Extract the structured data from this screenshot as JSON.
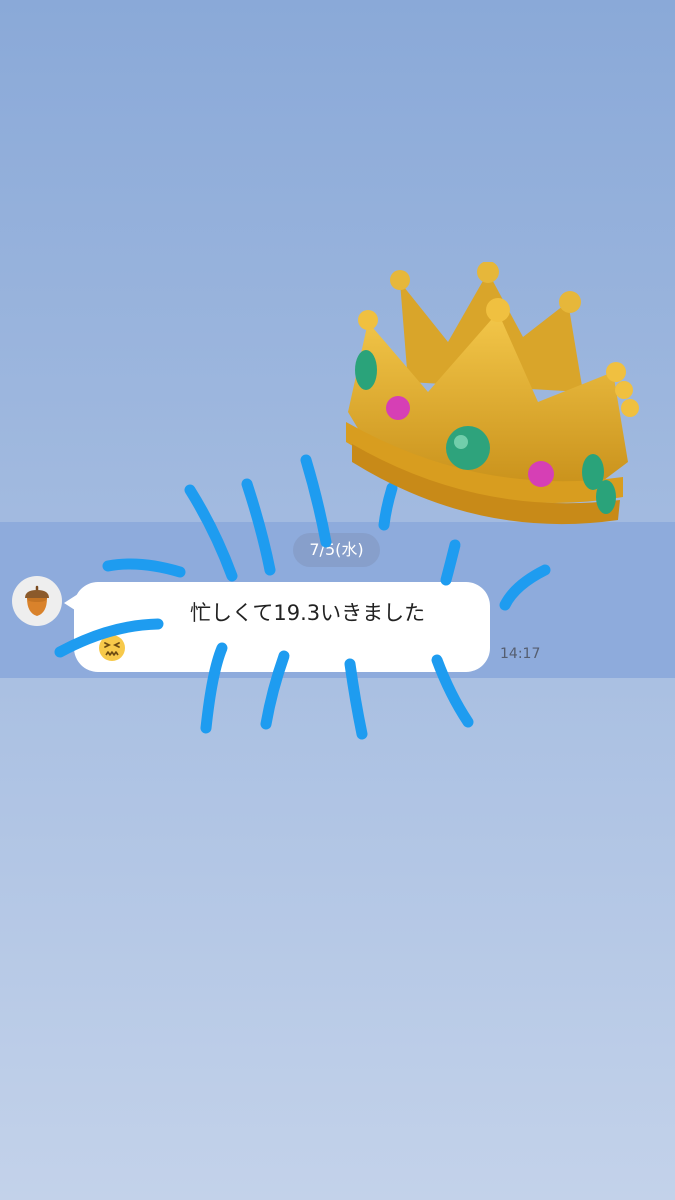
{
  "chat": {
    "date_separator": "7/5(水)",
    "message": {
      "text": "忙しくて19.3いきました",
      "emoji": "tired-face-emoji",
      "time": "14:17"
    },
    "avatar_icon": "acorn-icon"
  },
  "overlays": {
    "sticker": "crown-sticker",
    "drawing": "blue-scribble-lines",
    "drawing_color": "#1e9cf0"
  }
}
